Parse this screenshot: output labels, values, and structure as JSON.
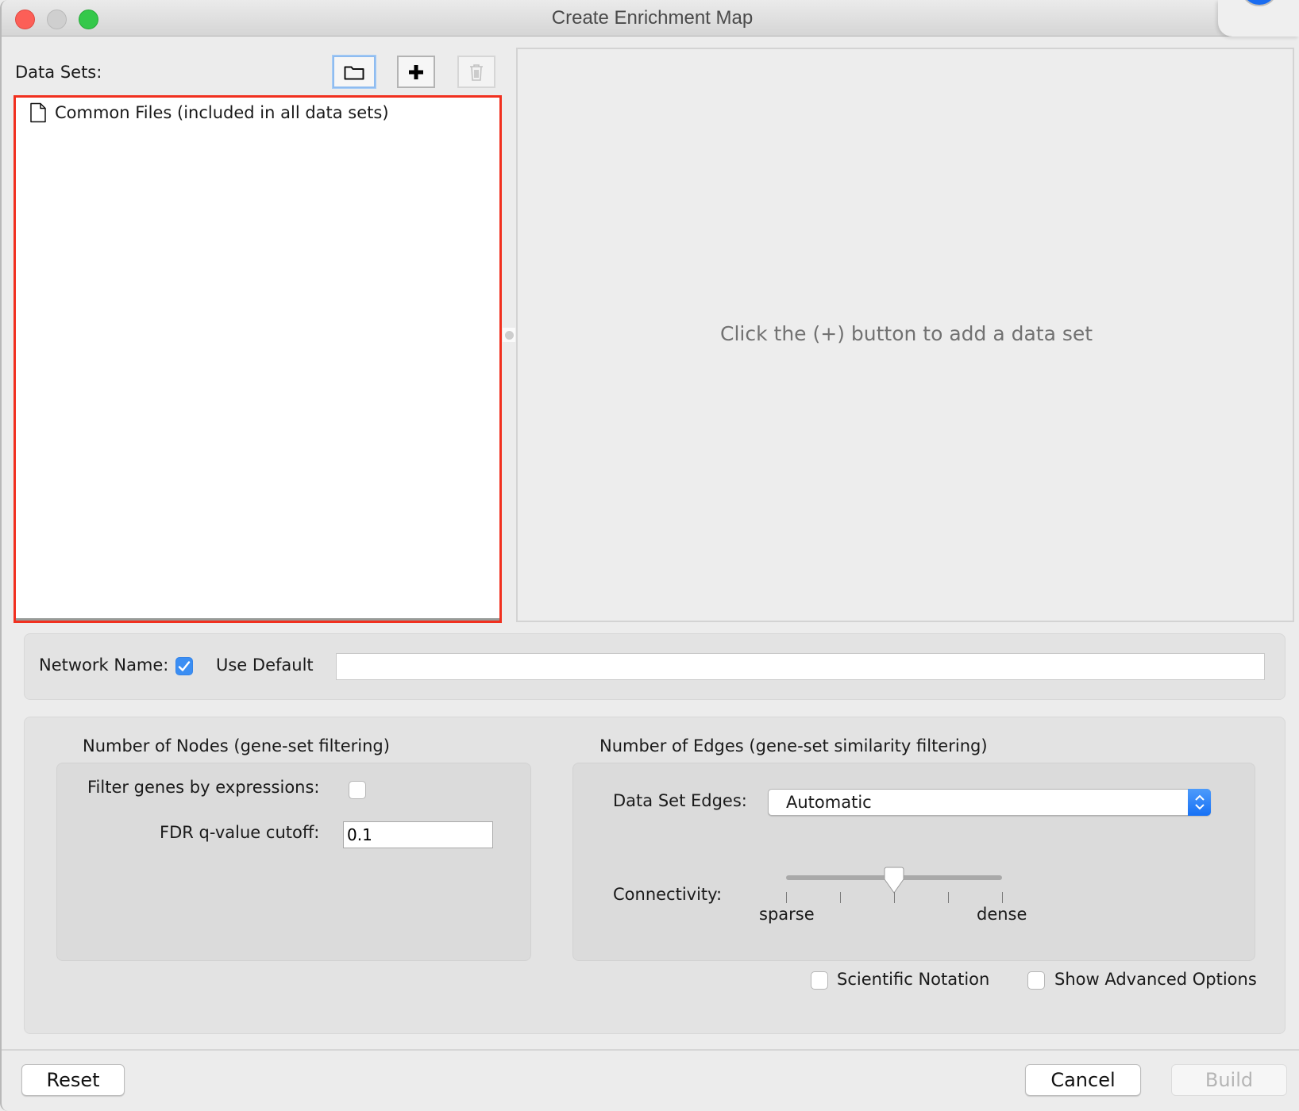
{
  "window": {
    "title": "Create Enrichment Map",
    "controls": [
      "close",
      "minimize",
      "maximize"
    ]
  },
  "data_sets": {
    "label": "Data Sets:",
    "toolbar": {
      "open_folder_icon": "folder-icon",
      "add_icon": "plus-icon",
      "delete_icon": "trash-icon"
    },
    "items": [
      {
        "icon": "document-icon",
        "label": "Common Files (included in all data sets)"
      }
    ],
    "empty_message": "Click the (+) button to add a data set"
  },
  "network_name": {
    "label": "Network Name:",
    "use_default_label": "Use Default",
    "use_default_checked": true,
    "value": "",
    "placeholder": ""
  },
  "nodes": {
    "title": "Number of Nodes (gene-set filtering)",
    "filter_genes_label": "Filter genes by expressions:",
    "filter_genes_checked": false,
    "fdr_label": "FDR q-value cutoff:",
    "fdr_value": "0.1"
  },
  "edges": {
    "title": "Number of Edges (gene-set similarity filtering)",
    "data_set_edges_label": "Data Set Edges:",
    "data_set_edges_value": "Automatic",
    "connectivity_label": "Connectivity:",
    "connectivity_min_label": "sparse",
    "connectivity_max_label": "dense",
    "connectivity_tick_count": 5,
    "connectivity_value_fraction": 0.5
  },
  "options": {
    "scientific_notation_label": "Scientific Notation",
    "scientific_notation_checked": false,
    "show_advanced_label": "Show Advanced Options",
    "show_advanced_checked": false
  },
  "buttons": {
    "reset": "Reset",
    "cancel": "Cancel",
    "build": "Build",
    "build_enabled": false
  },
  "colors": {
    "selection_border": "#f1301f",
    "accent": "#3b8ef3",
    "disabled_text": "#b5b5b5",
    "placeholder_text": "#727272"
  }
}
